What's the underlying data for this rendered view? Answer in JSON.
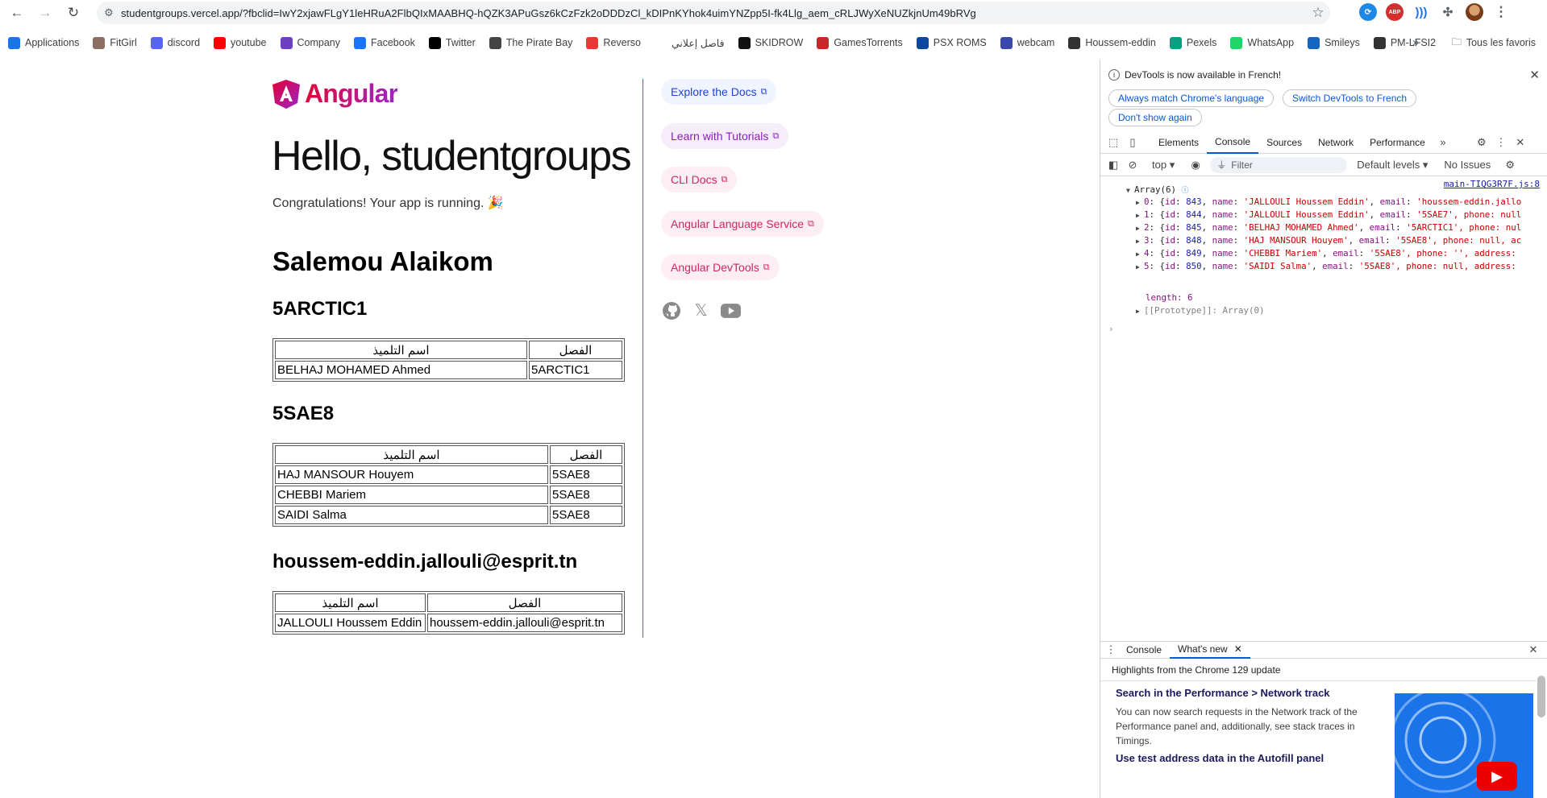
{
  "browser": {
    "url": "studentgroups.vercel.app/?fbclid=IwY2xjawFLgY1leHRuA2FlbQIxMAABHQ-hQZK3APuGsz6kCzFzk2oDDDzCl_kDIPnKYhok4uimYNZpp5I-fk4Llg_aem_cRLJWyXeNUZkjnUm49bRVg",
    "bookmarks": [
      {
        "label": "Applications",
        "color": "#1a73e8"
      },
      {
        "label": "FitGirl",
        "color": "#8d6e63"
      },
      {
        "label": "discord",
        "color": "#5865f2"
      },
      {
        "label": "youtube",
        "color": "#ff0000"
      },
      {
        "label": "Company",
        "color": "#6c3fc5"
      },
      {
        "label": "Facebook",
        "color": "#1877f2"
      },
      {
        "label": "Twitter",
        "color": "#000000"
      },
      {
        "label": "The Pirate Bay",
        "color": "#444444"
      },
      {
        "label": "Reverso",
        "color": "#e53935"
      },
      {
        "label": "فاصل إعلاني",
        "color": "#ffffff"
      },
      {
        "label": "SKIDROW",
        "color": "#111111"
      },
      {
        "label": "GamesTorrents",
        "color": "#c62828"
      },
      {
        "label": "PSX ROMS",
        "color": "#0d47a1"
      },
      {
        "label": "webcam",
        "color": "#3949ab"
      },
      {
        "label": "Houssem-eddin",
        "color": "#333333"
      },
      {
        "label": "Pexels",
        "color": "#05a081"
      },
      {
        "label": "WhatsApp",
        "color": "#25d366"
      },
      {
        "label": "Smileys",
        "color": "#1565c0"
      },
      {
        "label": "PM-LFSI2",
        "color": "#333333"
      }
    ],
    "bookmarks_folder": "Tous les favoris"
  },
  "app": {
    "logo_text": "Angular",
    "hello": "Hello, studentgroups",
    "congrats": "Congratulations! Your app is running. 🎉",
    "greeting": "Salemou Alaikom",
    "groups": [
      {
        "title": "5ARCTIC1",
        "col_name": "اسم التلميذ",
        "col_class": "الفصل",
        "rows": [
          {
            "name": "BELHAJ MOHAMED Ahmed",
            "class": "5ARCTIC1"
          }
        ]
      },
      {
        "title": "5SAE8",
        "col_name": "اسم التلميذ",
        "col_class": "الفصل",
        "rows": [
          {
            "name": "HAJ MANSOUR Houyem",
            "class": "5SAE8"
          },
          {
            "name": "CHEBBI Mariem",
            "class": "5SAE8"
          },
          {
            "name": "SAIDI Salma",
            "class": "5SAE8"
          }
        ]
      },
      {
        "title": "houssem-eddin.jallouli@esprit.tn",
        "col_name": "اسم التلميذ",
        "col_class": "الفصل",
        "rows": [
          {
            "name": "JALLOULI Houssem Eddin",
            "class": "houssem-eddin.jallouli@esprit.tn"
          }
        ]
      }
    ],
    "links": [
      "Explore the Docs",
      "Learn with Tutorials",
      "CLI Docs",
      "Angular Language Service",
      "Angular DevTools"
    ],
    "social_icons": [
      "github-icon",
      "x-icon",
      "youtube-icon"
    ]
  },
  "devtools": {
    "info_text": "DevTools is now available in French!",
    "info_buttons": [
      "Always match Chrome's language",
      "Switch DevTools to French",
      "Don't show again"
    ],
    "tabs": [
      "Elements",
      "Console",
      "Sources",
      "Network",
      "Performance"
    ],
    "active_tab": "Console",
    "context": "top",
    "filter_placeholder": "Filter",
    "levels": "Default levels",
    "issues": "No Issues",
    "source_link": "main-TIQG3R7F.js:8",
    "array_label": "Array(6)",
    "length_line": "length: 6",
    "prototype_line": "[[Prototype]]: Array(0)",
    "entries": [
      {
        "idx": "0",
        "id": "843",
        "name": "'JALLOULI Houssem Eddin'",
        "tail_key": "email",
        "tail": "'houssem-eddin.jallo"
      },
      {
        "idx": "1",
        "id": "844",
        "name": "'JALLOULI Houssem Eddin'",
        "tail_key": "email",
        "tail": "'5SAE7', phone: null"
      },
      {
        "idx": "2",
        "id": "845",
        "name": "'BELHAJ MOHAMED Ahmed'",
        "tail_key": "email",
        "tail": "'5ARCTIC1', phone: nul"
      },
      {
        "idx": "3",
        "id": "848",
        "name": "'HAJ MANSOUR Houyem'",
        "tail_key": "email",
        "tail": "'5SAE8', phone: null, ac"
      },
      {
        "idx": "4",
        "id": "849",
        "name": "'CHEBBI Mariem'",
        "tail_key": "email",
        "tail": "'5SAE8', phone: '', address:"
      },
      {
        "idx": "5",
        "id": "850",
        "name": "'SAIDI Salma'",
        "tail_key": "email",
        "tail": "'5SAE8', phone: null, address:"
      }
    ],
    "drawer_tabs": [
      "Console",
      "What's new"
    ],
    "whatsnew_subtitle": "Highlights from the Chrome 129 update",
    "whatsnew_heading1": "Search in the Performance > Network track",
    "whatsnew_para1": "You can now search requests in the Network track of the Performance panel and, additionally, see stack traces in Timings.",
    "whatsnew_heading2": "Use test address data in the Autofill panel"
  }
}
